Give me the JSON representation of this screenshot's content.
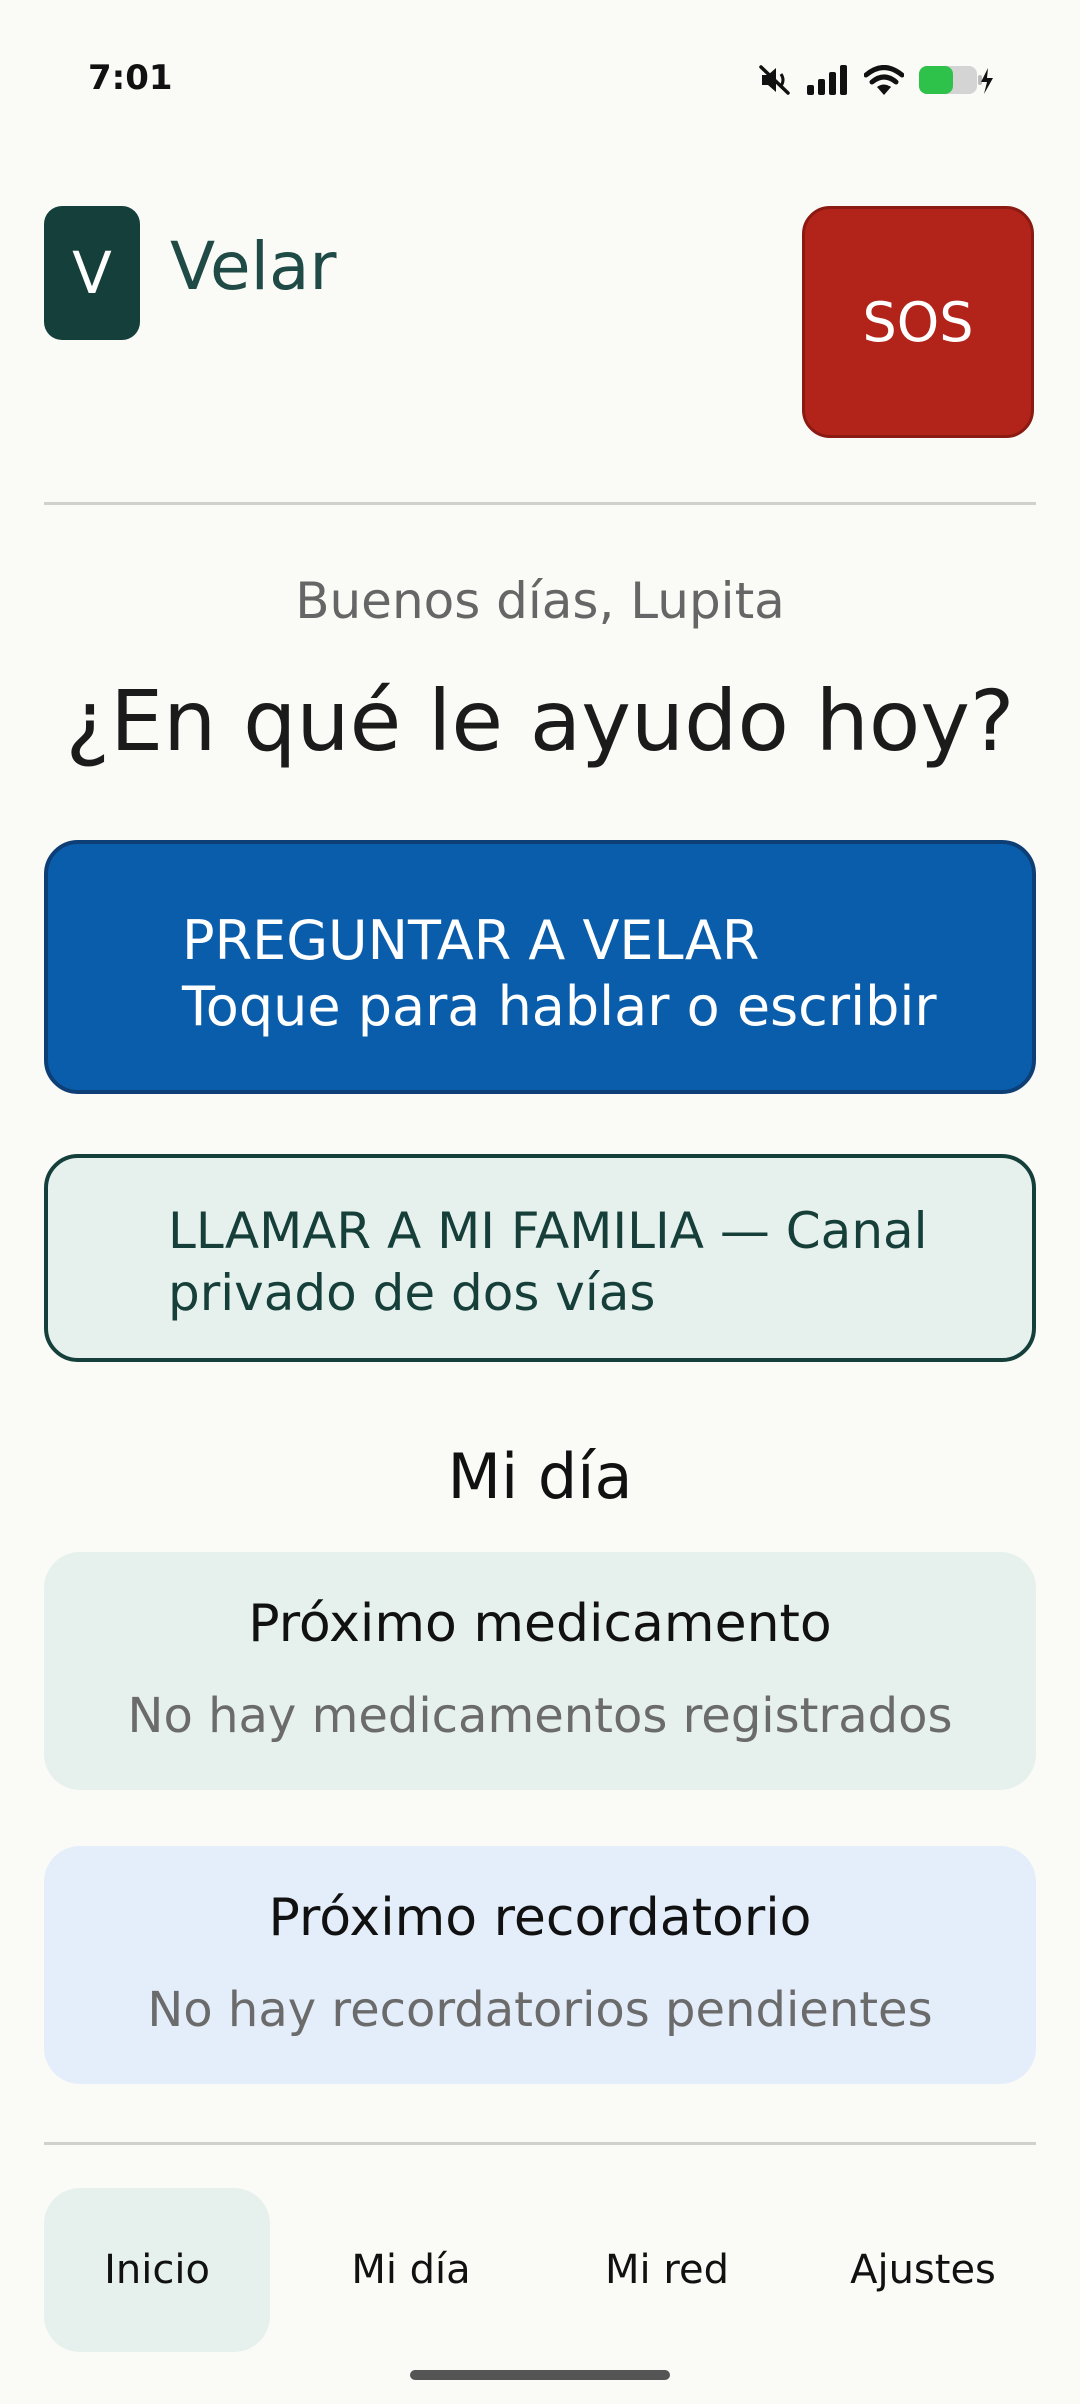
{
  "status_bar": {
    "time": "7:01",
    "icons": [
      "mute-icon",
      "signal-icon",
      "wifi-icon",
      "battery-charging-icon"
    ]
  },
  "header": {
    "logo_letter": "V",
    "app_name": "Velar",
    "sos_label": "SOS"
  },
  "greeting": "Buenos días, Lupita",
  "question": "¿En qué le ayudo hoy?",
  "ask_button": {
    "title": "PREGUNTAR A VELAR",
    "subtitle": "Toque para hablar o escribir"
  },
  "family_button": {
    "label": "LLAMAR A MI FAMILIA — Canal privado de dos vías"
  },
  "my_day": {
    "title": "Mi día",
    "medication": {
      "title": "Próximo medicamento",
      "status": "No hay medicamentos registrados"
    },
    "reminder": {
      "title": "Próximo recordatorio",
      "status": "No hay recordatorios pendientes"
    }
  },
  "nav": {
    "items": [
      {
        "label": "Inicio",
        "active": true
      },
      {
        "label": "Mi día",
        "active": false
      },
      {
        "label": "Mi red",
        "active": false
      },
      {
        "label": "Ajustes",
        "active": false
      }
    ]
  },
  "colors": {
    "background": "#fafaf6",
    "brand_dark": "#143f3a",
    "sos_red": "#b22419",
    "primary_blue": "#0a5dab",
    "mint": "#e6f1ee",
    "light_blue": "#e4eefa"
  }
}
